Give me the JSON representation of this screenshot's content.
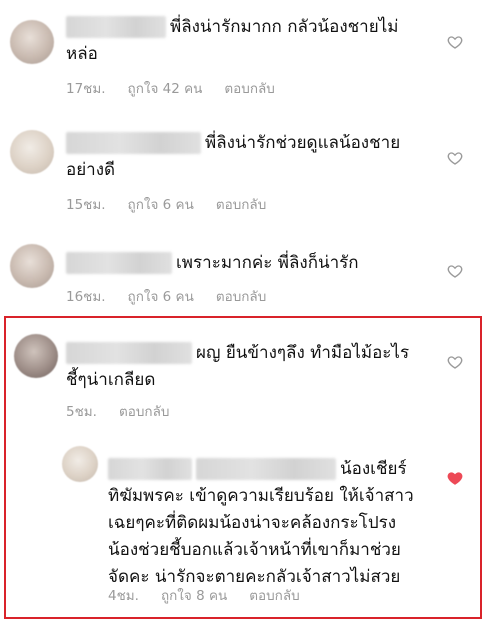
{
  "comments": [
    {
      "text_line1": "พี่ลิงน่ารักมากก กลัวน้องชายไม่",
      "text_line2": "หล่อ",
      "time": "17ชม.",
      "likes": "ถูกใจ 42 คน",
      "reply": "ตอบกลับ",
      "liked": false
    },
    {
      "text_line1": "พี่ลิงน่ารักช่วยดูแลน้องชาย",
      "text_line2": "อย่างดี",
      "time": "15ชม.",
      "likes": "ถูกใจ 6 คน",
      "reply": "ตอบกลับ",
      "liked": false
    },
    {
      "text_line1": "เพราะมากค่ะ พี่ลิงก็น่ารัก",
      "time": "16ชม.",
      "likes": "ถูกใจ 6 คน",
      "reply": "ตอบกลับ",
      "liked": false
    },
    {
      "text_line1": "ผญ ยืนข้างๆลึง ทำมือไม้อะไร",
      "text_line2": "ชี้ๆน่าเกลียด",
      "time": "5ชม.",
      "reply": "ตอบกลับ",
      "liked": false
    }
  ],
  "reply_comment": {
    "line1": "น้องเชียร์",
    "line2": "ทิฆัมพรคะ เข้าดูความเรียบร้อย ให้เจ้าสาว",
    "line3": "เฉยๆคะที่ติดผมน้องน่าจะคล้องกระโปรง",
    "line4": "น้องช่วยชี้บอกแล้วเจ้าหน้าที่เขาก็มาช่วย",
    "line5": "จัดคะ น่ารักจะตายคะกลัวเจ้าสาวไม่สวย",
    "time": "4ชม.",
    "likes": "ถูกใจ 8 คน",
    "reply": "ตอบกลับ",
    "liked": true
  },
  "colors": {
    "heart_liked": "#ed4956",
    "heart_outline": "#9a9a9a",
    "highlight_border": "#d9232a"
  }
}
